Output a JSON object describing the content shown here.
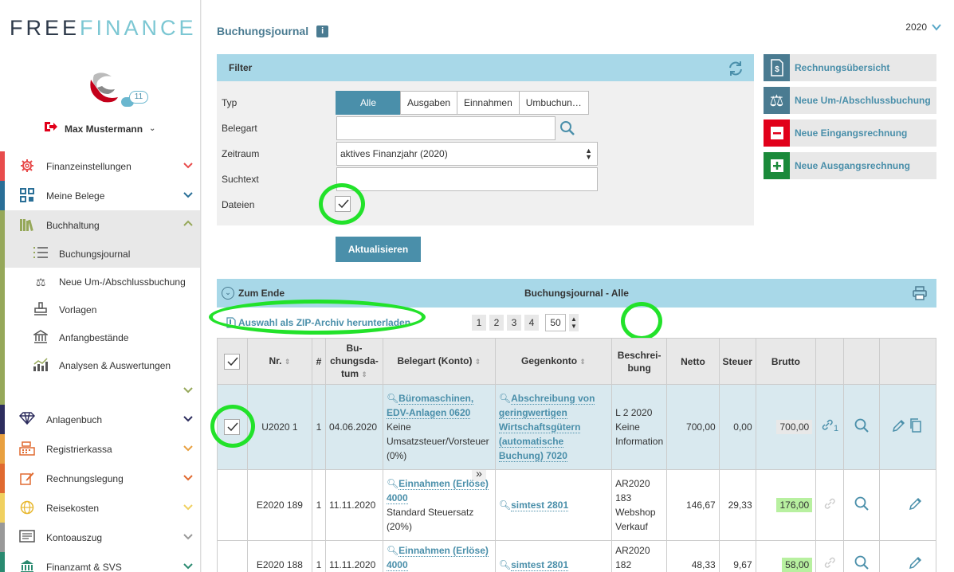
{
  "brand": {
    "free": "FREE",
    "finance": "FINANCE"
  },
  "user": {
    "name": "Max Mustermann",
    "chat_count": "11"
  },
  "nav": [
    {
      "label": "Finanzeinstellungen",
      "color": "#e84c4c"
    },
    {
      "label": "Meine Belege",
      "color": "#2a6f97"
    },
    {
      "label": "Buchhaltung",
      "color": "#96a85a"
    },
    {
      "label": "Anlagenbuch",
      "color": "#2d2d5e"
    },
    {
      "label": "Registrierkassa",
      "color": "#e8a040"
    },
    {
      "label": "Rechnungslegung",
      "color": "#e06a30"
    },
    {
      "label": "Reisekosten",
      "color": "#f0d060"
    },
    {
      "label": "Kontoauszug",
      "color": "#999999"
    },
    {
      "label": "Finanzamt & SVS",
      "color": "#2a8a70"
    }
  ],
  "subnav": [
    "Buchungsjournal",
    "Neue Um-/Abschlussbuchung",
    "Vorlagen",
    "Anfangbestände",
    "Analysen & Auswertungen"
  ],
  "page": {
    "title": "Buchungsjournal",
    "year": "2020"
  },
  "filter": {
    "title": "Filter",
    "typ_label": "Typ",
    "typ_options": [
      "Alle",
      "Ausgaben",
      "Einnahmen",
      "Umbuchun…"
    ],
    "belegart_label": "Belegart",
    "belegart_value": "",
    "zeitraum_label": "Zeitraum",
    "zeitraum_value": "aktives Finanzjahr (2020)",
    "suchtext_label": "Suchtext",
    "suchtext_value": "",
    "dateien_label": "Dateien",
    "submit": "Aktualisieren"
  },
  "actions": [
    {
      "label": "Rechnungsübersicht",
      "color": "#4a7b91"
    },
    {
      "label": "Neue Um-/Abschlussbuchung",
      "color": "#4a7b91"
    },
    {
      "label": "Neue Eingangsrechnung",
      "color": "#e1001a"
    },
    {
      "label": "Neue Ausgangsrechnung",
      "color": "#1a8a3a"
    }
  ],
  "journal": {
    "to_end": "Zum Ende",
    "title": "Buchungsjournal - Alle",
    "zip": "Auswahl als ZIP-Archiv herunterladen",
    "pages": [
      "1",
      "2",
      "3",
      "4"
    ],
    "page_size": "50",
    "headers": {
      "nr": "Nr.",
      "hash": "#",
      "datum": "Bu-chungsda-tum",
      "belegart": "Belegart (Konto)",
      "gegen": "Gegenkonto",
      "beschr": "Beschrei-bung",
      "netto": "Netto",
      "steuer": "Steuer",
      "brutto": "Brutto"
    },
    "rows": [
      {
        "nr": "U2020 1",
        "hash": "1",
        "datum": "04.06.2020",
        "beleg_link": "Büromaschinen, EDV-Anlagen 0620",
        "beleg_text": "Keine Umsatzsteuer/Vorsteuer (0%)",
        "gegen": "Abschreibung von geringwertigen Wirtschaftsgütern (automatische Buchung) 7020",
        "beschr": "L 2 2020 Keine Information",
        "netto": "700,00",
        "steuer": "0,00",
        "brutto": "700,00",
        "link_count": "1"
      },
      {
        "nr": "E2020 189",
        "hash": "1",
        "datum": "11.11.2020",
        "beleg_link": "Einnahmen (Erlöse) 4000",
        "beleg_text": "Standard Steuersatz (20%)",
        "gegen": "simtest 2801",
        "beschr": "AR2020 183 Webshop Verkauf",
        "netto": "146,67",
        "steuer": "29,33",
        "brutto": "176,00",
        "link_count": ""
      },
      {
        "nr": "E2020 188",
        "hash": "1",
        "datum": "11.11.2020",
        "beleg_link": "Einnahmen (Erlöse) 4000",
        "beleg_text": "",
        "gegen": "simtest 2801",
        "beschr": "AR2020 182",
        "netto": "48,33",
        "steuer": "9,67",
        "brutto": "58,00",
        "link_count": ""
      }
    ]
  }
}
